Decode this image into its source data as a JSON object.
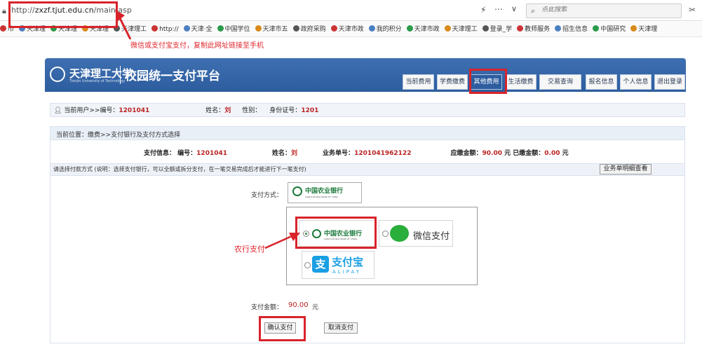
{
  "browser": {
    "url_prefix": "http://",
    "url_host": "zxzf.tjut.edu.cn",
    "url_path": "/main.asp",
    "search_placeholder": "点此搜索",
    "bookmarks": [
      "市",
      "天津理",
      "天津理",
      "天津理",
      "天津理工",
      "http://",
      "天津·全",
      "中国学位",
      "天津市五",
      "政府采购",
      "天津市政",
      "我的积分",
      "天津市政",
      "天津理工",
      "登录_学",
      "教师服务",
      "招生信息",
      "中国研究",
      "天津理"
    ]
  },
  "annotations": {
    "copy_hint": "微信或支付宝支付，复制此网址链接至手机",
    "abc_pay": "农行支付"
  },
  "header": {
    "school_name": "天津理工大学",
    "school_en": "Tianjin University of Technology",
    "system_name": "校园统一支付平台",
    "nav": [
      "当前费用",
      "学费缴费",
      "其他费用",
      "生活缴费",
      "交易查询",
      "报名信息",
      "个人信息",
      "退出登录"
    ]
  },
  "user_bar": {
    "prefix": "当前用户>>编号：",
    "id": "1201041",
    "name_label": "姓名：",
    "name": "刘",
    "gender_label": "性别：",
    "idcard_label": "身份证号：",
    "idcard": "1201"
  },
  "breadcrumb": "当前位置：缴费>>支付银行及支付方式选择",
  "pay_info": {
    "label": "支付信息：",
    "no_label": "编号：",
    "no": "1201041",
    "name_label": "姓名：",
    "name": "刘",
    "order_label": "业务单号：",
    "order": "1201041962122",
    "due_label": "应缴金额：",
    "due": "90.00",
    "yuan1": "元",
    "paid_label": "已缴金额：",
    "paid": "0.00",
    "yuan2": "元"
  },
  "select_hint": "请选择付款方式 (说明：选择支付银行，可以全额或拆分支付，在一笔交易完成后才能进行下一笔支付)",
  "detail_button": "业务单明细查看",
  "method_label": "支付方式：",
  "options": {
    "abc_name": "中国农业银行",
    "abc_en": "AGRICULTURAL BANK OF CHINA",
    "wechat": "微信支付",
    "alipay": "支付宝",
    "alipay_en": "ALIPAY"
  },
  "amount": {
    "label": "支付金额：",
    "value": "90.00",
    "unit": "元"
  },
  "buttons": {
    "confirm": "确认支付",
    "cancel": "取消支付"
  },
  "colors": {
    "banner": "#2d5d9f",
    "highlight_red": "#d8232a",
    "abc_green": "#1b7a3a",
    "wechat_green": "#2aae3c",
    "alipay_blue": "#1a9fe3"
  }
}
